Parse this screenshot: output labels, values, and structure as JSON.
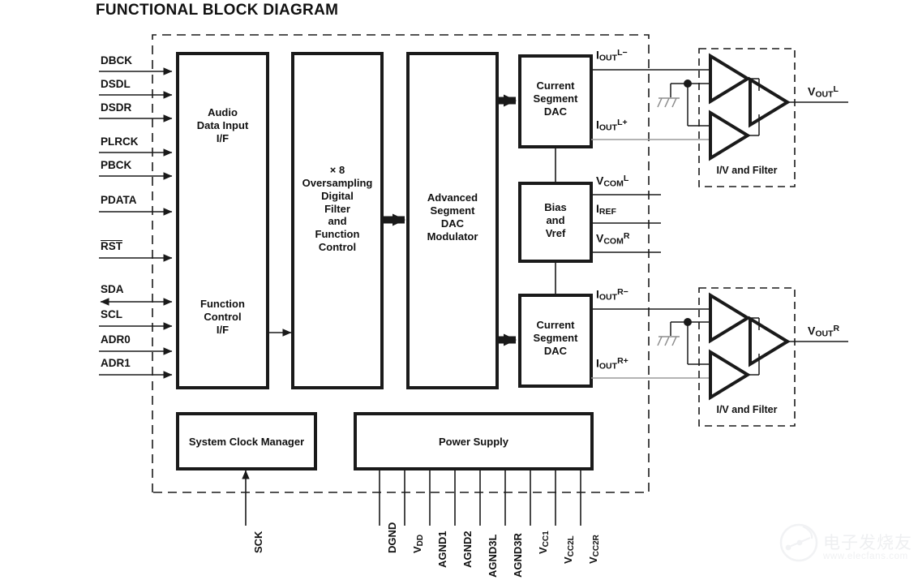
{
  "header": {
    "title": "FUNCTIONAL BLOCK DIAGRAM"
  },
  "blocks": {
    "audio_data_input": {
      "line1": "Audio",
      "line2": "Data Input",
      "line3": "I/F"
    },
    "function_control": {
      "line1": "Function",
      "line2": "Control",
      "line3": "I/F"
    },
    "digital_filter": {
      "line1": "× 8",
      "line2": "Oversampling",
      "line3": "Digital",
      "line4": "Filter",
      "line5": "and",
      "line6": "Function",
      "line7": "Control"
    },
    "modulator": {
      "line1": "Advanced",
      "line2": "Segment",
      "line3": "DAC",
      "line4": "Modulator"
    },
    "current_dac_left": {
      "line1": "Current",
      "line2": "Segment",
      "line3": "DAC"
    },
    "current_dac_right": {
      "line1": "Current",
      "line2": "Segment",
      "line3": "DAC"
    },
    "bias_vref": {
      "line1": "Bias",
      "line2": "and",
      "line3": "Vref"
    },
    "system_clock_manager": {
      "label": "System Clock Manager"
    },
    "power_supply": {
      "label": "Power Supply"
    },
    "iv_filter_left": {
      "label": "I/V and Filter"
    },
    "iv_filter_right": {
      "label": "I/V and Filter"
    }
  },
  "input_pins": [
    {
      "name": "DBCK",
      "direction": "in"
    },
    {
      "name": "DSDL",
      "direction": "in"
    },
    {
      "name": "DSDR",
      "direction": "in"
    },
    {
      "name": "PLRCK",
      "direction": "in"
    },
    {
      "name": "PBCK",
      "direction": "in"
    },
    {
      "name": "PDATA",
      "direction": "in"
    },
    {
      "name": "RST",
      "direction": "in",
      "overline": true
    },
    {
      "name": "SDA",
      "direction": "bidirectional"
    },
    {
      "name": "SCL",
      "direction": "in"
    },
    {
      "name": "ADR0",
      "direction": "in"
    },
    {
      "name": "ADR1",
      "direction": "in"
    }
  ],
  "output_signals": {
    "iout_l_minus": {
      "base": "I",
      "sub": "OUT",
      "sup": "L−"
    },
    "iout_l_plus": {
      "base": "I",
      "sub": "OUT",
      "sup": "L+"
    },
    "iout_r_minus": {
      "base": "I",
      "sub": "OUT",
      "sup": "R−"
    },
    "iout_r_plus": {
      "base": "I",
      "sub": "OUT",
      "sup": "R+"
    },
    "vcom_l": {
      "base": "V",
      "sub": "COM",
      "sup": "L"
    },
    "iref": {
      "base": "I",
      "sub": "REF",
      "sup": ""
    },
    "vcom_r": {
      "base": "V",
      "sub": "COM",
      "sup": "R"
    },
    "vout_l": {
      "base": "V",
      "sub": "OUT",
      "sup": "L"
    },
    "vout_r": {
      "base": "V",
      "sub": "OUT",
      "sup": "R"
    }
  },
  "clock_pin": {
    "name": "SCK"
  },
  "supply_pins": [
    {
      "name": "DGND",
      "sub": ""
    },
    {
      "name": "V",
      "sub": "DD"
    },
    {
      "name": "AGND1",
      "sub": ""
    },
    {
      "name": "AGND2",
      "sub": ""
    },
    {
      "name": "AGND3L",
      "sub": ""
    },
    {
      "name": "AGND3R",
      "sub": ""
    },
    {
      "name": "V",
      "sub": "CC1"
    },
    {
      "name": "V",
      "sub": "CC2L"
    },
    {
      "name": "V",
      "sub": "CC2R"
    }
  ],
  "watermark": {
    "text": "电子发烧友",
    "url": "www.elecfans.com"
  },
  "colors": {
    "line": "#1a1a1a",
    "light_line": "#9a9a9a",
    "text": "#111111",
    "background": "#ffffff"
  }
}
